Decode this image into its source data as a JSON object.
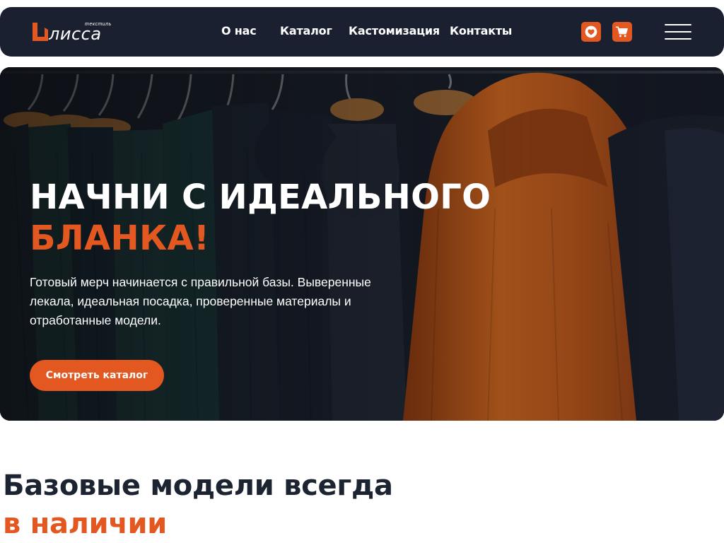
{
  "brand": {
    "name": "лисса",
    "subtitle": "текстиль",
    "accent_color": "#e35820",
    "dark_color": "#1b2030"
  },
  "nav": {
    "items": [
      {
        "label": "О нас"
      },
      {
        "label": "Каталог"
      },
      {
        "label": "Кастомизация"
      },
      {
        "label": "Контакты"
      }
    ]
  },
  "header_icons": {
    "favorites": "heart-icon",
    "cart": "cart-icon",
    "menu": "hamburger-menu-icon"
  },
  "hero": {
    "title_line1": "НАЧНИ С ИДЕАЛЬНОГО",
    "title_line2": "БЛАНКА!",
    "text": "Готовый мерч начинается с правильной базы. Выверенные лекала, идеальная посадка, проверенные материалы и отработанные модели.",
    "button_label": "Смотреть каталог"
  },
  "section": {
    "title_line1": "Базовые модели всегда",
    "title_line2": "в наличии"
  }
}
